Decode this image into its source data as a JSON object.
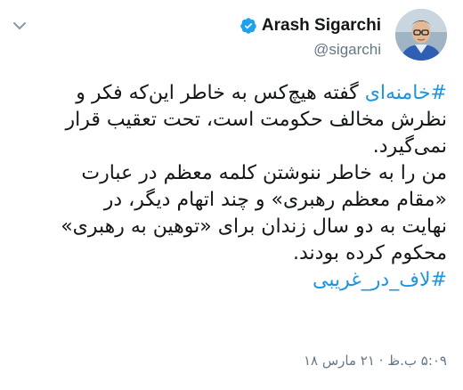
{
  "author": {
    "display_name": "Arash Sigarchi",
    "handle": "@sigarchi",
    "verified": true
  },
  "tweet": {
    "lines": [
      {
        "hashtag": "#خامنه‌ای",
        "text": " گفته هیچ‌کس به خاطر این‌که فکر و"
      },
      {
        "text": "نظرش مخالف حکومت است، تحت تعقیب قرار"
      },
      {
        "text": "نمی‌گیرد."
      },
      {
        "text": "من را به خاطر ننوشتن کلمه معظم در عبارت"
      },
      {
        "text": "«مقام معظم رهبری» و چند اتهام دیگر، در"
      },
      {
        "text": "نهایت به دو سال زندان برای «توهین به رهبری»"
      },
      {
        "text": "محکوم کرده بودند."
      }
    ],
    "closing_hashtag": "#لاف_در_غریبی",
    "timestamp": "۵:۰۹ ب.ظ · ۲۱ مارس ۱۸"
  },
  "colors": {
    "text": "#14171a",
    "hashtag": "#1b95e0",
    "muted": "#657786",
    "verified": "#1da1f2"
  },
  "icons": {
    "menu": "chevron-down-icon",
    "verified": "verified-badge-icon"
  }
}
